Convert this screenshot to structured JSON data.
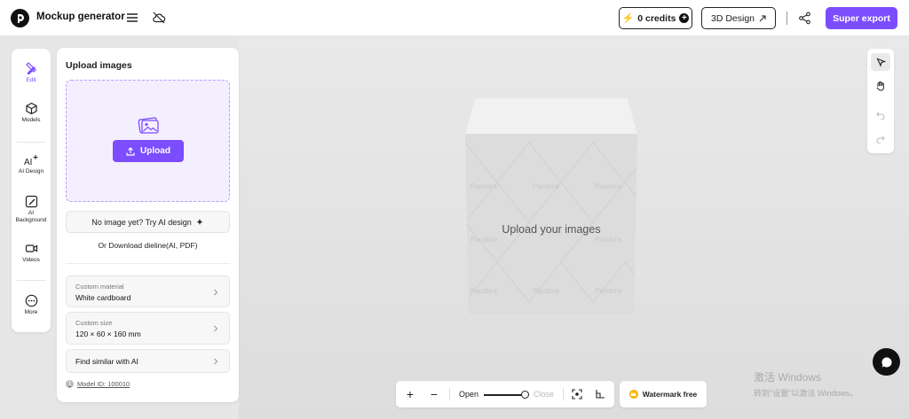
{
  "header": {
    "app_title": "Mockup generator",
    "credits_label": "0 credits",
    "design3d_label": "3D Design",
    "export_label": "Super export"
  },
  "rail": {
    "items": [
      {
        "label": "Edit",
        "active": true
      },
      {
        "label": "Models"
      },
      {
        "label": "AI Design"
      },
      {
        "label": "AI Background"
      },
      {
        "label": "Videos"
      },
      {
        "label": "More"
      }
    ]
  },
  "panel": {
    "title": "Upload images",
    "upload_label": "Upload",
    "ai_label": "No image yet? Try AI design",
    "dieline_label": "Or Download dieline(AI, PDF)",
    "rows": [
      {
        "caption": "Custom material",
        "value": "White cardboard"
      },
      {
        "caption": "Custom size",
        "value": "120 × 60 × 160 mm"
      },
      {
        "value": "Find similar with AI"
      }
    ],
    "model_id": "Model ID: 100010"
  },
  "canvas": {
    "message": "Upload your images"
  },
  "zoombar": {
    "open_label": "Open",
    "close_label": "Close",
    "level": 1.0
  },
  "watermark_label": "Watermark free",
  "windows_watermark": {
    "line1": "激活 Windows",
    "line2": "转到\"设置\"以激活 Windows。"
  },
  "colors": {
    "accent": "#7b4dff",
    "dropzone_bg": "#f4efff"
  }
}
